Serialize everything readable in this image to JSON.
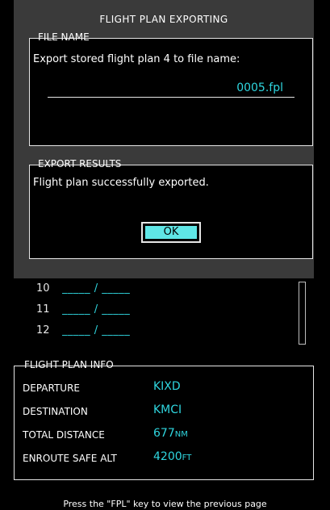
{
  "dialog": {
    "title": "FLIGHT PLAN EXPORTING",
    "file_name": {
      "label": "FILE NAME",
      "prompt": "Export stored flight plan 4 to file name:",
      "value": "0005.fpl"
    },
    "export_results": {
      "label": "EXPORT RESULTS",
      "message": "Flight plan successfully exported.",
      "ok_label": "OK"
    }
  },
  "list": {
    "rows": [
      {
        "num": "10",
        "value": "_____ / _____"
      },
      {
        "num": "11",
        "value": "_____ / _____"
      },
      {
        "num": "12",
        "value": "_____ / _____"
      }
    ]
  },
  "info": {
    "label": "FLIGHT PLAN INFO",
    "departure_label": "DEPARTURE",
    "departure_value": "KIXD",
    "destination_label": "DESTINATION",
    "destination_value": "KMCI",
    "distance_label": "TOTAL DISTANCE",
    "distance_value": "677",
    "distance_unit": "NM",
    "alt_label": "ENROUTE SAFE ALT",
    "alt_value": "4200",
    "alt_unit": "FT"
  },
  "footer": "Press the \"FPL\" key to view the previous page",
  "colors": {
    "accent": "#2fd6df",
    "dialog_bg": "#3a3a3a",
    "button": "#5fe6e6"
  }
}
